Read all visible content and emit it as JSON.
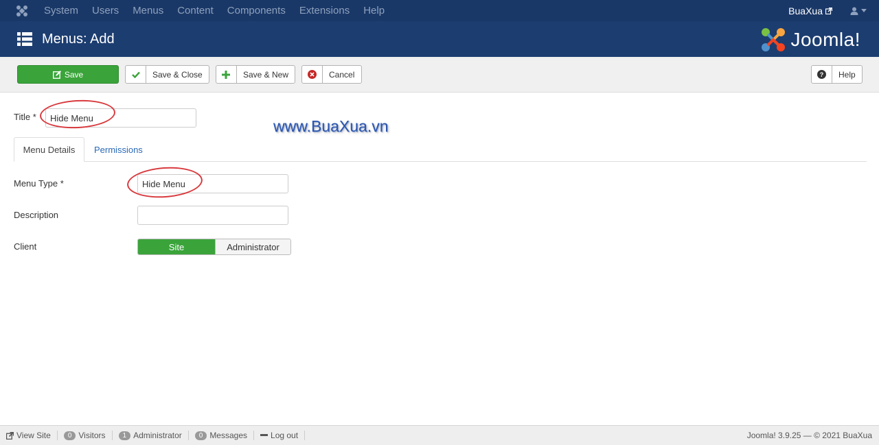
{
  "topbar": {
    "menu": [
      "System",
      "Users",
      "Menus",
      "Content",
      "Components",
      "Extensions",
      "Help"
    ],
    "site_name": "BuaXua"
  },
  "header": {
    "title": "Menus: Add",
    "brand": "Joomla!"
  },
  "toolbar": {
    "save": "Save",
    "save_close": "Save & Close",
    "save_new": "Save & New",
    "cancel": "Cancel",
    "help": "Help"
  },
  "form": {
    "title_label": "Title *",
    "title_value": "Hide Menu",
    "tabs": [
      "Menu Details",
      "Permissions"
    ],
    "menu_type_label": "Menu Type *",
    "menu_type_value": "Hide Menu",
    "description_label": "Description",
    "description_value": "",
    "client_label": "Client",
    "client_options": [
      "Site",
      "Administrator"
    ],
    "client_selected": "Site"
  },
  "watermark": "www.BuaXua.vn",
  "footer": {
    "view_site": "View Site",
    "visitors_count": "0",
    "visitors": "Visitors",
    "admin_count": "1",
    "admin": "Administrator",
    "messages_count": "0",
    "messages": "Messages",
    "logout": "Log out",
    "copyright": "Joomla! 3.9.25  —  © 2021 BuaXua"
  },
  "colors": {
    "navbar": "#1a3867",
    "header": "#1c3d70",
    "success": "#3aa43a",
    "annotation": "#d8393d",
    "link": "#2a69b8"
  }
}
